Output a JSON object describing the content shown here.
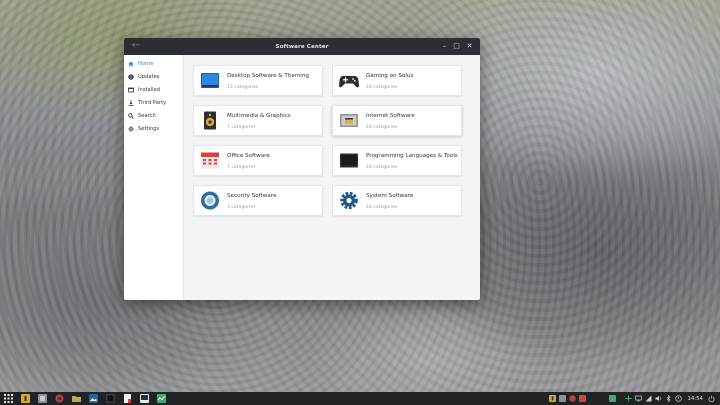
{
  "window": {
    "title": "Software Center"
  },
  "sidebar": {
    "items": [
      {
        "label": "Home",
        "icon": "home-icon",
        "active": true
      },
      {
        "label": "Updates",
        "icon": "info-icon",
        "active": false
      },
      {
        "label": "Installed",
        "icon": "installed-icon",
        "active": false
      },
      {
        "label": "Third Party",
        "icon": "download-icon",
        "active": false
      },
      {
        "label": "Search",
        "icon": "search-icon",
        "active": false
      },
      {
        "label": "Settings",
        "icon": "gear-icon",
        "active": false
      }
    ]
  },
  "categories": [
    {
      "title": "Desktop Software & Theming",
      "sub": "15 categories",
      "icon": "desktop-icon"
    },
    {
      "title": "Gaming on Solus",
      "sub": "10 categories",
      "icon": "gamepad-icon"
    },
    {
      "title": "Multimedia & Graphics",
      "sub": "7 categories",
      "icon": "speaker-icon"
    },
    {
      "title": "Internet Software",
      "sub": "10 categories",
      "icon": "network-icon"
    },
    {
      "title": "Office Software",
      "sub": "7 categories",
      "icon": "calendar-icon"
    },
    {
      "title": "Programming Languages & Tools",
      "sub": "10 categories",
      "icon": "terminal-icon"
    },
    {
      "title": "Security Software",
      "sub": "3 categories",
      "icon": "shield-icon"
    },
    {
      "title": "System Software",
      "sub": "16 categories",
      "icon": "system-gear-icon"
    }
  ],
  "taskbar": {
    "clock": "14:54"
  },
  "colors": {
    "accent": "#2a8ec4",
    "titlebar": "#2b2f33",
    "taskbar": "#1f2326"
  }
}
